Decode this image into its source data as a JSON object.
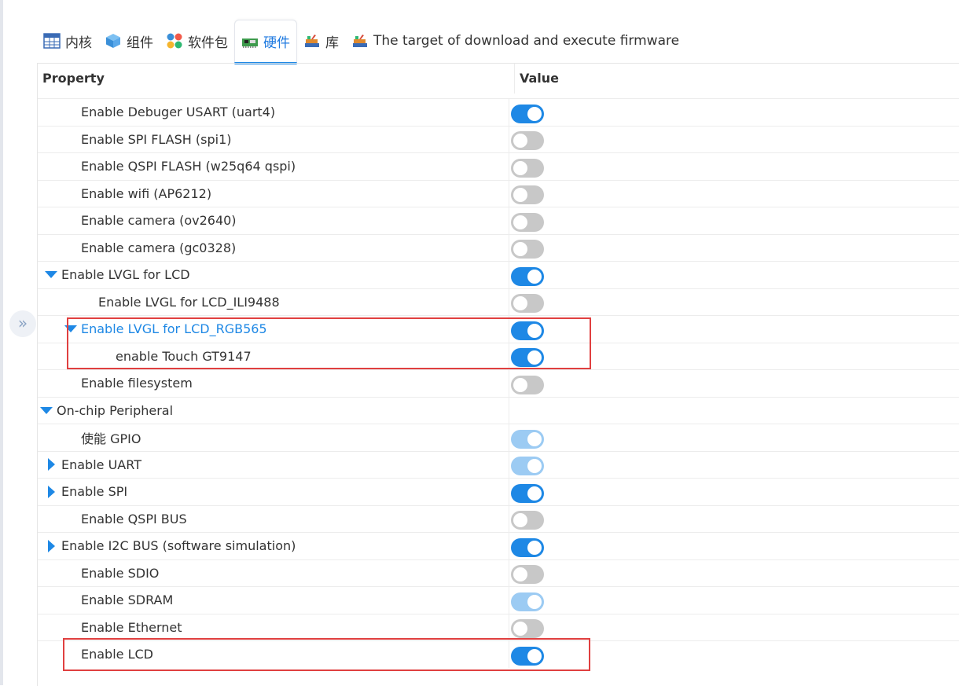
{
  "tabs": [
    {
      "label": "内核",
      "icon": "kernel-table-icon"
    },
    {
      "label": "组件",
      "icon": "component-cube-icon"
    },
    {
      "label": "软件包",
      "icon": "packages-dots-icon"
    },
    {
      "label": "硬件",
      "icon": "hardware-board-icon",
      "active": true
    },
    {
      "label": "库",
      "icon": "library-books-icon"
    },
    {
      "label": "The target of download and execute firmware",
      "icon": "target-books-icon"
    }
  ],
  "table": {
    "col_property": "Property",
    "col_value": "Value"
  },
  "rows": [
    {
      "label": "Enable Debuger USART (uart4)",
      "indent": 2,
      "arrow": "none",
      "state": "on"
    },
    {
      "label": "Enable SPI FLASH (spi1)",
      "indent": 2,
      "arrow": "none",
      "state": "off"
    },
    {
      "label": "Enable QSPI FLASH (w25q64 qspi)",
      "indent": 2,
      "arrow": "none",
      "state": "off"
    },
    {
      "label": "Enable wifi (AP6212)",
      "indent": 2,
      "arrow": "none",
      "state": "off"
    },
    {
      "label": "Enable camera (ov2640)",
      "indent": 2,
      "arrow": "none",
      "state": "off"
    },
    {
      "label": "Enable camera (gc0328)",
      "indent": 2,
      "arrow": "none",
      "state": "off"
    },
    {
      "label": "Enable LVGL for LCD",
      "indent": 1,
      "arrow": "down",
      "state": "on"
    },
    {
      "label": "Enable LVGL for LCD_ILI9488",
      "indent": 3,
      "arrow": "none",
      "state": "off"
    },
    {
      "label": "Enable LVGL for LCD_RGB565",
      "indent": 2,
      "arrow": "down",
      "state": "on",
      "highlight": true
    },
    {
      "label": "enable Touch GT9147",
      "indent": 4,
      "arrow": "none",
      "state": "on"
    },
    {
      "label": "Enable filesystem",
      "indent": 2,
      "arrow": "none",
      "state": "off"
    },
    {
      "label": "On-chip Peripheral",
      "indent": 0,
      "arrow": "down",
      "state": "none"
    },
    {
      "label": "使能 GPIO",
      "indent": 2,
      "arrow": "none",
      "state": "disabled-on"
    },
    {
      "label": "Enable UART",
      "indent": 1,
      "arrow": "right",
      "state": "disabled-on"
    },
    {
      "label": "Enable SPI",
      "indent": 1,
      "arrow": "right",
      "state": "on"
    },
    {
      "label": "Enable QSPI BUS",
      "indent": 2,
      "arrow": "none",
      "state": "off"
    },
    {
      "label": "Enable I2C BUS (software simulation)",
      "indent": 1,
      "arrow": "right",
      "state": "on"
    },
    {
      "label": "Enable SDIO",
      "indent": 2,
      "arrow": "none",
      "state": "off"
    },
    {
      "label": "Enable SDRAM",
      "indent": 2,
      "arrow": "none",
      "state": "disabled-on"
    },
    {
      "label": "Enable Ethernet",
      "indent": 2,
      "arrow": "none",
      "state": "off"
    },
    {
      "label": "Enable LCD",
      "indent": 2,
      "arrow": "none",
      "state": "on"
    }
  ],
  "colors": {
    "accent": "#1e88e5",
    "switch_off": "#c8c8c8",
    "switch_disabled": "#9ccbf3",
    "annotation": "#e04040"
  }
}
